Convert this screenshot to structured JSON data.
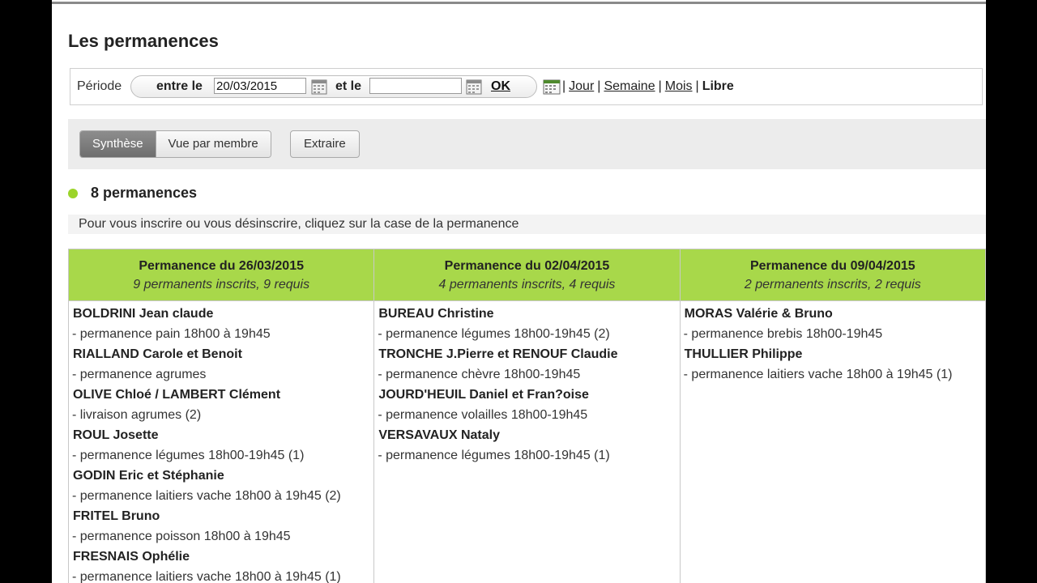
{
  "page": {
    "title": "Les permanences"
  },
  "period": {
    "label": "Période",
    "between_label": "entre le",
    "start_value": "20/03/2015",
    "and_label": "et le",
    "end_value": "",
    "ok_label": "OK",
    "views": [
      "Jour",
      "Semaine",
      "Mois",
      "Libre"
    ],
    "active_view": "Libre",
    "separator": "|"
  },
  "tabs": {
    "synthese": "Synthèse",
    "vue_membre": "Vue par membre",
    "extraire": "Extraire",
    "active": "Synthèse"
  },
  "summary": {
    "count_text": "8 permanences",
    "hint": "Pour vous inscrire ou vous désinscrire, cliquez sur la case de la permanence"
  },
  "colors": {
    "header_green": "#a8d84a",
    "dot_green": "#9bd42a"
  },
  "columns": [
    {
      "title": "Permanence du 26/03/2015",
      "subtitle": "9 permanents inscrits, 9 requis",
      "entries": [
        {
          "name": "BOLDRINI Jean claude",
          "desc": "- permanence pain 18h00 à 19h45"
        },
        {
          "name": "RIALLAND Carole et Benoit",
          "desc": "- permanence agrumes"
        },
        {
          "name": "OLIVE Chloé / LAMBERT Clément",
          "desc": "- livraison agrumes (2)"
        },
        {
          "name": "ROUL Josette",
          "desc": "- permanence légumes 18h00-19h45 (1)"
        },
        {
          "name": "GODIN Eric et Stéphanie",
          "desc": "- permanence laitiers vache 18h00 à 19h45 (2)"
        },
        {
          "name": "FRITEL Bruno",
          "desc": "- permanence poisson 18h00 à 19h45"
        },
        {
          "name": "FRESNAIS Ophélie",
          "desc": "- permanence laitiers vache 18h00 à 19h45 (1)"
        }
      ]
    },
    {
      "title": "Permanence du 02/04/2015",
      "subtitle": "4 permanents inscrits, 4 requis",
      "entries": [
        {
          "name": "BUREAU Christine",
          "desc": "- permanence légumes 18h00-19h45 (2)"
        },
        {
          "name": "TRONCHE J.Pierre et RENOUF Claudie",
          "desc": "- permanence chèvre 18h00-19h45"
        },
        {
          "name": "JOURD'HEUIL Daniel et Fran?oise",
          "desc": "- permanence volailles 18h00-19h45"
        },
        {
          "name": "VERSAVAUX Nataly",
          "desc": "- permanence légumes 18h00-19h45 (1)"
        }
      ]
    },
    {
      "title": "Permanence du 09/04/2015",
      "subtitle": "2 permanents inscrits, 2 requis",
      "entries": [
        {
          "name": "MORAS Valérie & Bruno",
          "desc": "- permanence brebis 18h00-19h45"
        },
        {
          "name": "THULLIER Philippe",
          "desc": "- permanence laitiers vache 18h00 à 19h45 (1)"
        }
      ]
    }
  ]
}
